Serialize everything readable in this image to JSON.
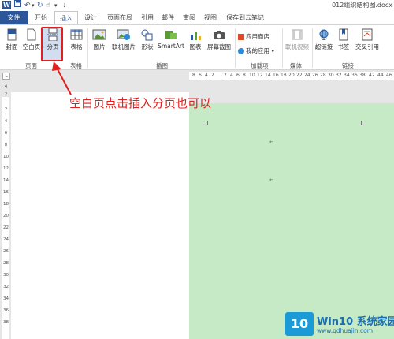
{
  "window": {
    "app_icon_letter": "W",
    "doc_title": "012组织结构图.docx"
  },
  "quick_access": {
    "save_icon": "save-icon",
    "undo_icon": "undo-icon",
    "redo_icon": "redo-icon",
    "touch_icon": "touch-mode-icon",
    "customize_icon": "customize-icon"
  },
  "tabs": [
    "文件",
    "开始",
    "插入",
    "设计",
    "页面布局",
    "引用",
    "邮件",
    "审阅",
    "视图",
    "保存到云笔记"
  ],
  "ribbon": {
    "pages_group": {
      "label": "页面",
      "cover": "封面",
      "blank_page": "空白页",
      "page_break": "分页"
    },
    "table_group": {
      "label": "表格",
      "table": "表格"
    },
    "illustrations_group": {
      "label": "插图",
      "picture": "图片",
      "online_picture": "联机图片",
      "shapes": "形状",
      "smartart": "SmartArt",
      "chart": "图表",
      "screenshot": "屏幕截图"
    },
    "addins_group": {
      "label": "加载项",
      "store": "应用商店",
      "my_apps": "我的应用"
    },
    "media_group": {
      "label": "媒体",
      "online_video": "联机视频"
    },
    "links_group": {
      "label": "链接",
      "hyperlink": "超链接",
      "bookmark": "书签",
      "cross_reference": "交叉引用"
    }
  },
  "ruler": {
    "toggle_label": "L",
    "left_numbers": [
      "8",
      "6",
      "4",
      "2"
    ],
    "right_numbers": [
      "2",
      "4",
      "6",
      "8",
      "10",
      "12",
      "14",
      "16",
      "18",
      "20",
      "22",
      "24",
      "26",
      "28",
      "30",
      "32",
      "34",
      "36",
      "38",
      "42",
      "44",
      "46"
    ],
    "vertical_numbers": [
      "4",
      "2",
      "2",
      "4",
      "6",
      "8",
      "10",
      "12",
      "14",
      "16",
      "18",
      "20",
      "22",
      "24",
      "26",
      "28",
      "30",
      "32",
      "34",
      "36",
      "38"
    ]
  },
  "document": {
    "paragraph_mark": "↵"
  },
  "annotation": "空白页点击插入分页也可以",
  "watermark": {
    "badge": "10",
    "title": "Win10 系统家园",
    "url": "www.qdhuajin.com"
  },
  "colors": {
    "word_blue": "#2b579a",
    "highlight_red": "#e02020",
    "page_green": "#c6e9c6",
    "watermark_blue": "#1a9bd8"
  }
}
